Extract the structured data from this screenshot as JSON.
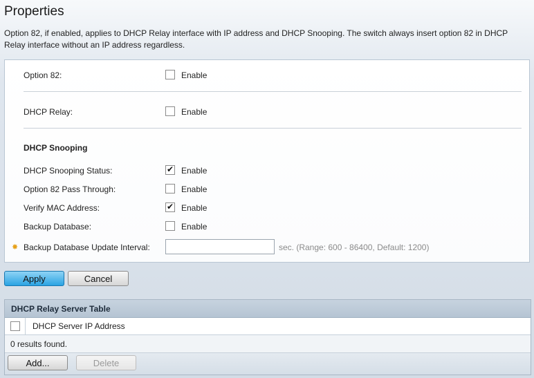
{
  "page": {
    "title": "Properties",
    "description": "Option 82, if enabled, applies to DHCP Relay interface with IP address and DHCP Snooping. The switch always insert option 82 in DHCP Relay interface without an IP address regardless."
  },
  "form": {
    "option82": {
      "label": "Option 82:",
      "enable_label": "Enable",
      "checked": false
    },
    "dhcp_relay": {
      "label": "DHCP Relay:",
      "enable_label": "Enable",
      "checked": false
    },
    "snooping_heading": "DHCP Snooping",
    "snooping_status": {
      "label": "DHCP Snooping Status:",
      "enable_label": "Enable",
      "checked": true
    },
    "option82_pass": {
      "label": "Option 82 Pass Through:",
      "enable_label": "Enable",
      "checked": false
    },
    "verify_mac": {
      "label": "Verify MAC Address:",
      "enable_label": "Enable",
      "checked": true
    },
    "backup_db": {
      "label": "Backup Database:",
      "enable_label": "Enable",
      "checked": false
    },
    "backup_interval": {
      "label": "Backup Database Update Interval:",
      "value": "",
      "hint": "sec. (Range: 600 - 86400, Default: 1200)"
    }
  },
  "buttons": {
    "apply": "Apply",
    "cancel": "Cancel"
  },
  "relay_table": {
    "title": "DHCP Relay Server Table",
    "column": "DHCP Server IP Address",
    "status": "0 results found.",
    "add": "Add...",
    "delete": "Delete"
  },
  "colors": {
    "accent": "#2aa3e3",
    "required": "#e6a11a"
  }
}
